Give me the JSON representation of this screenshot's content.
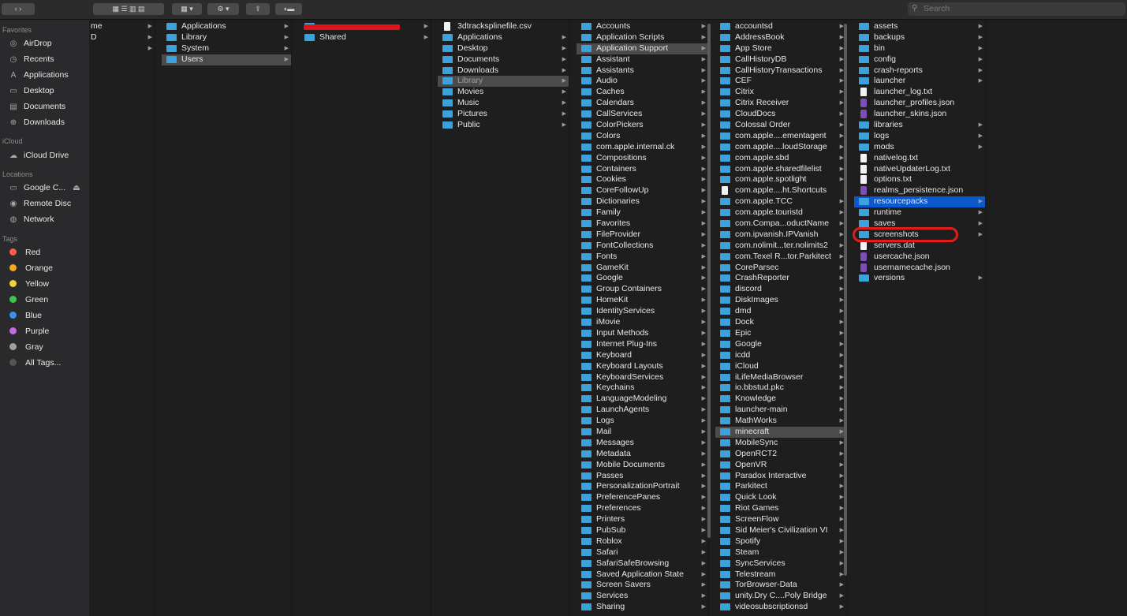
{
  "toolbar": {
    "search_placeholder": "Search"
  },
  "sidebar": {
    "favorites_header": "Favorites",
    "favorites": [
      {
        "icon": "airdrop-icon",
        "glyph": "◎",
        "label": "AirDrop"
      },
      {
        "icon": "recents-icon",
        "glyph": "◷",
        "label": "Recents"
      },
      {
        "icon": "applications-icon",
        "glyph": "A",
        "label": "Applications"
      },
      {
        "icon": "desktop-icon",
        "glyph": "▭",
        "label": "Desktop"
      },
      {
        "icon": "documents-icon",
        "glyph": "▤",
        "label": "Documents"
      },
      {
        "icon": "downloads-icon",
        "glyph": "⊕",
        "label": "Downloads"
      }
    ],
    "icloud_header": "iCloud",
    "icloud": [
      {
        "icon": "cloud-icon",
        "glyph": "☁",
        "label": "iCloud Drive"
      }
    ],
    "locations_header": "Locations",
    "locations": [
      {
        "icon": "disk-icon",
        "glyph": "▭",
        "label": "Google C...",
        "eject": "⏏"
      },
      {
        "icon": "remote-disc-icon",
        "glyph": "◉",
        "label": "Remote Disc"
      },
      {
        "icon": "network-icon",
        "glyph": "◍",
        "label": "Network"
      }
    ],
    "tags_header": "Tags",
    "tags": [
      {
        "label": "Red",
        "color": "#ff5a52"
      },
      {
        "label": "Orange",
        "color": "#f5a623"
      },
      {
        "label": "Yellow",
        "color": "#f4d03f"
      },
      {
        "label": "Green",
        "color": "#3fc34a"
      },
      {
        "label": "Blue",
        "color": "#3b8ef5"
      },
      {
        "label": "Purple",
        "color": "#c36be3"
      },
      {
        "label": "Gray",
        "color": "#a0a0a0"
      },
      {
        "label": "All Tags...",
        "color": "#555555"
      }
    ]
  },
  "columns": [
    {
      "name": "col-root",
      "items": [
        {
          "label": "me",
          "arrow": true
        },
        {
          "label": "D",
          "arrow": true
        },
        {
          "label": "",
          "arrow": true
        }
      ]
    },
    {
      "name": "col-macintosh-hd",
      "items": [
        {
          "label": "Applications",
          "folder": true,
          "arrow": true
        },
        {
          "label": "Library",
          "folder": true,
          "arrow": true
        },
        {
          "label": "System",
          "folder": true,
          "arrow": true
        },
        {
          "label": "Users",
          "folder": true,
          "arrow": true,
          "selected": true
        }
      ]
    },
    {
      "name": "col-users",
      "items": [
        {
          "label": "",
          "folder": true,
          "arrow": true,
          "redacted": true
        },
        {
          "label": "Shared",
          "folder": true,
          "arrow": true
        }
      ]
    },
    {
      "name": "col-home",
      "items": [
        {
          "label": "3dtracksplinefile.csv",
          "doc": true
        },
        {
          "label": "Applications",
          "folder": true,
          "arrow": true
        },
        {
          "label": "Desktop",
          "folder": true,
          "arrow": true
        },
        {
          "label": "Documents",
          "folder": true,
          "arrow": true
        },
        {
          "label": "Downloads",
          "folder": true,
          "arrow": true
        },
        {
          "label": "Library",
          "folder": true,
          "arrow": true,
          "selected": true,
          "dim": true
        },
        {
          "label": "Movies",
          "folder": true,
          "arrow": true
        },
        {
          "label": "Music",
          "folder": true,
          "arrow": true
        },
        {
          "label": "Pictures",
          "folder": true,
          "arrow": true
        },
        {
          "label": "Public",
          "folder": true,
          "arrow": true
        }
      ]
    },
    {
      "name": "col-library",
      "items": [
        {
          "label": "Accounts",
          "folder": true,
          "arrow": true
        },
        {
          "label": "Application Scripts",
          "folder": true,
          "arrow": true
        },
        {
          "label": "Application Support",
          "folder": true,
          "arrow": true,
          "selected": true
        },
        {
          "label": "Assistant",
          "folder": true,
          "arrow": true
        },
        {
          "label": "Assistants",
          "folder": true,
          "arrow": true
        },
        {
          "label": "Audio",
          "folder": true,
          "arrow": true
        },
        {
          "label": "Caches",
          "folder": true,
          "arrow": true
        },
        {
          "label": "Calendars",
          "folder": true,
          "arrow": true
        },
        {
          "label": "CallServices",
          "folder": true,
          "arrow": true
        },
        {
          "label": "ColorPickers",
          "folder": true,
          "arrow": true
        },
        {
          "label": "Colors",
          "folder": true,
          "arrow": true
        },
        {
          "label": "com.apple.internal.ck",
          "folder": true,
          "arrow": true
        },
        {
          "label": "Compositions",
          "folder": true,
          "arrow": true
        },
        {
          "label": "Containers",
          "folder": true,
          "arrow": true
        },
        {
          "label": "Cookies",
          "folder": true,
          "arrow": true
        },
        {
          "label": "CoreFollowUp",
          "folder": true,
          "arrow": true
        },
        {
          "label": "Dictionaries",
          "folder": true,
          "arrow": true
        },
        {
          "label": "Family",
          "folder": true,
          "arrow": true
        },
        {
          "label": "Favorites",
          "folder": true,
          "arrow": true
        },
        {
          "label": "FileProvider",
          "folder": true,
          "arrow": true
        },
        {
          "label": "FontCollections",
          "folder": true,
          "arrow": true
        },
        {
          "label": "Fonts",
          "folder": true,
          "arrow": true
        },
        {
          "label": "GameKit",
          "folder": true,
          "arrow": true
        },
        {
          "label": "Google",
          "folder": true,
          "arrow": true
        },
        {
          "label": "Group Containers",
          "folder": true,
          "arrow": true
        },
        {
          "label": "HomeKit",
          "folder": true,
          "arrow": true
        },
        {
          "label": "IdentityServices",
          "folder": true,
          "arrow": true
        },
        {
          "label": "iMovie",
          "folder": true,
          "arrow": true
        },
        {
          "label": "Input Methods",
          "folder": true,
          "arrow": true
        },
        {
          "label": "Internet Plug-Ins",
          "folder": true,
          "arrow": true
        },
        {
          "label": "Keyboard",
          "folder": true,
          "arrow": true
        },
        {
          "label": "Keyboard Layouts",
          "folder": true,
          "arrow": true
        },
        {
          "label": "KeyboardServices",
          "folder": true,
          "arrow": true
        },
        {
          "label": "Keychains",
          "folder": true,
          "arrow": true
        },
        {
          "label": "LanguageModeling",
          "folder": true,
          "arrow": true
        },
        {
          "label": "LaunchAgents",
          "folder": true,
          "arrow": true
        },
        {
          "label": "Logs",
          "folder": true,
          "arrow": true
        },
        {
          "label": "Mail",
          "folder": true,
          "arrow": true
        },
        {
          "label": "Messages",
          "folder": true,
          "arrow": true
        },
        {
          "label": "Metadata",
          "folder": true,
          "arrow": true
        },
        {
          "label": "Mobile Documents",
          "folder": true,
          "arrow": true
        },
        {
          "label": "Passes",
          "folder": true,
          "arrow": true
        },
        {
          "label": "PersonalizationPortrait",
          "folder": true,
          "arrow": true
        },
        {
          "label": "PreferencePanes",
          "folder": true,
          "arrow": true
        },
        {
          "label": "Preferences",
          "folder": true,
          "arrow": true
        },
        {
          "label": "Printers",
          "folder": true,
          "arrow": true
        },
        {
          "label": "PubSub",
          "folder": true,
          "arrow": true
        },
        {
          "label": "Roblox",
          "folder": true,
          "arrow": true
        },
        {
          "label": "Safari",
          "folder": true,
          "arrow": true
        },
        {
          "label": "SafariSafeBrowsing",
          "folder": true,
          "arrow": true
        },
        {
          "label": "Saved Application State",
          "folder": true,
          "arrow": true
        },
        {
          "label": "Screen Savers",
          "folder": true,
          "arrow": true
        },
        {
          "label": "Services",
          "folder": true,
          "arrow": true
        },
        {
          "label": "Sharing",
          "folder": true,
          "arrow": true
        }
      ]
    },
    {
      "name": "col-application-support",
      "items": [
        {
          "label": "accountsd",
          "folder": true,
          "arrow": true
        },
        {
          "label": "AddressBook",
          "folder": true,
          "arrow": true
        },
        {
          "label": "App Store",
          "folder": true,
          "arrow": true
        },
        {
          "label": "CallHistoryDB",
          "folder": true,
          "arrow": true
        },
        {
          "label": "CallHistoryTransactions",
          "folder": true,
          "arrow": true
        },
        {
          "label": "CEF",
          "folder": true,
          "arrow": true
        },
        {
          "label": "Citrix",
          "folder": true,
          "arrow": true
        },
        {
          "label": "Citrix Receiver",
          "folder": true,
          "arrow": true
        },
        {
          "label": "CloudDocs",
          "folder": true,
          "arrow": true
        },
        {
          "label": "Colossal Order",
          "folder": true,
          "arrow": true
        },
        {
          "label": "com.apple....ementagent",
          "folder": true,
          "arrow": true
        },
        {
          "label": "com.apple....loudStorage",
          "folder": true,
          "arrow": true
        },
        {
          "label": "com.apple.sbd",
          "folder": true,
          "arrow": true
        },
        {
          "label": "com.apple.sharedfilelist",
          "folder": true,
          "arrow": true
        },
        {
          "label": "com.apple.spotlight",
          "folder": true,
          "arrow": true
        },
        {
          "label": "com.apple....ht.Shortcuts",
          "doc": true,
          "arrow": false
        },
        {
          "label": "com.apple.TCC",
          "folder": true,
          "arrow": true
        },
        {
          "label": "com.apple.touristd",
          "folder": true,
          "arrow": true
        },
        {
          "label": "com.Compa...oductName",
          "folder": true,
          "arrow": true
        },
        {
          "label": "com.ipvanish.IPVanish",
          "folder": true,
          "arrow": true
        },
        {
          "label": "com.nolimit...ter.nolimits2",
          "folder": true,
          "arrow": true
        },
        {
          "label": "com.Texel R...tor.Parkitect",
          "folder": true,
          "arrow": true
        },
        {
          "label": "CoreParsec",
          "folder": true,
          "arrow": true
        },
        {
          "label": "CrashReporter",
          "folder": true,
          "arrow": true
        },
        {
          "label": "discord",
          "folder": true,
          "arrow": true
        },
        {
          "label": "DiskImages",
          "folder": true,
          "arrow": true
        },
        {
          "label": "dmd",
          "folder": true,
          "arrow": true
        },
        {
          "label": "Dock",
          "folder": true,
          "arrow": true
        },
        {
          "label": "Epic",
          "folder": true,
          "arrow": true
        },
        {
          "label": "Google",
          "folder": true,
          "arrow": true
        },
        {
          "label": "icdd",
          "folder": true,
          "arrow": true
        },
        {
          "label": "iCloud",
          "folder": true,
          "arrow": true
        },
        {
          "label": "iLifeMediaBrowser",
          "folder": true,
          "arrow": true
        },
        {
          "label": "io.bbstud.pkc",
          "folder": true,
          "arrow": true
        },
        {
          "label": "Knowledge",
          "folder": true,
          "arrow": true
        },
        {
          "label": "launcher-main",
          "folder": true,
          "arrow": true
        },
        {
          "label": "MathWorks",
          "folder": true,
          "arrow": true
        },
        {
          "label": "minecraft",
          "folder": true,
          "arrow": true,
          "selected": true
        },
        {
          "label": "MobileSync",
          "folder": true,
          "arrow": true
        },
        {
          "label": "OpenRCT2",
          "folder": true,
          "arrow": true
        },
        {
          "label": "OpenVR",
          "folder": true,
          "arrow": true
        },
        {
          "label": "Paradox Interactive",
          "folder": true,
          "arrow": true
        },
        {
          "label": "Parkitect",
          "folder": true,
          "arrow": true
        },
        {
          "label": "Quick Look",
          "folder": true,
          "arrow": true
        },
        {
          "label": "Riot Games",
          "folder": true,
          "arrow": true
        },
        {
          "label": "ScreenFlow",
          "folder": true,
          "arrow": true
        },
        {
          "label": "Sid Meier's Civilization VI",
          "folder": true,
          "arrow": true
        },
        {
          "label": "Spotify",
          "folder": true,
          "arrow": true
        },
        {
          "label": "Steam",
          "folder": true,
          "arrow": true
        },
        {
          "label": "SyncServices",
          "folder": true,
          "arrow": true
        },
        {
          "label": "Telestream",
          "folder": true,
          "arrow": true
        },
        {
          "label": "TorBrowser-Data",
          "folder": true,
          "arrow": true
        },
        {
          "label": "unity.Dry C....Poly Bridge",
          "folder": true,
          "arrow": true
        },
        {
          "label": "videosubscriptionsd",
          "folder": true,
          "arrow": true
        }
      ]
    },
    {
      "name": "col-minecraft",
      "items": [
        {
          "label": "assets",
          "folder": true,
          "arrow": true
        },
        {
          "label": "backups",
          "folder": true,
          "arrow": true
        },
        {
          "label": "bin",
          "folder": true,
          "arrow": true
        },
        {
          "label": "config",
          "folder": true,
          "arrow": true
        },
        {
          "label": "crash-reports",
          "folder": true,
          "arrow": true
        },
        {
          "label": "launcher",
          "folder": true,
          "arrow": true
        },
        {
          "label": "launcher_log.txt",
          "doc": true
        },
        {
          "label": "launcher_profiles.json",
          "json": true
        },
        {
          "label": "launcher_skins.json",
          "json": true
        },
        {
          "label": "libraries",
          "folder": true,
          "arrow": true
        },
        {
          "label": "logs",
          "folder": true,
          "arrow": true
        },
        {
          "label": "mods",
          "folder": true,
          "arrow": true
        },
        {
          "label": "nativelog.txt",
          "doc": true
        },
        {
          "label": "nativeUpdaterLog.txt",
          "doc": true
        },
        {
          "label": "options.txt",
          "doc": true
        },
        {
          "label": "realms_persistence.json",
          "json": true
        },
        {
          "label": "resourcepacks",
          "folder": true,
          "arrow": true,
          "selectedBlue": true
        },
        {
          "label": "runtime",
          "folder": true,
          "arrow": true
        },
        {
          "label": "saves",
          "folder": true,
          "arrow": true
        },
        {
          "label": "screenshots",
          "folder": true,
          "arrow": true
        },
        {
          "label": "servers.dat",
          "doc": true
        },
        {
          "label": "usercache.json",
          "json": true
        },
        {
          "label": "usernamecache.json",
          "json": true
        },
        {
          "label": "versions",
          "folder": true,
          "arrow": true
        }
      ]
    }
  ],
  "colors": {
    "selection_blue": "#0c59cf",
    "selection_gray": "#4b4b4d",
    "folder": "#3ba3dc",
    "annotation_red": "#e01d1d"
  }
}
